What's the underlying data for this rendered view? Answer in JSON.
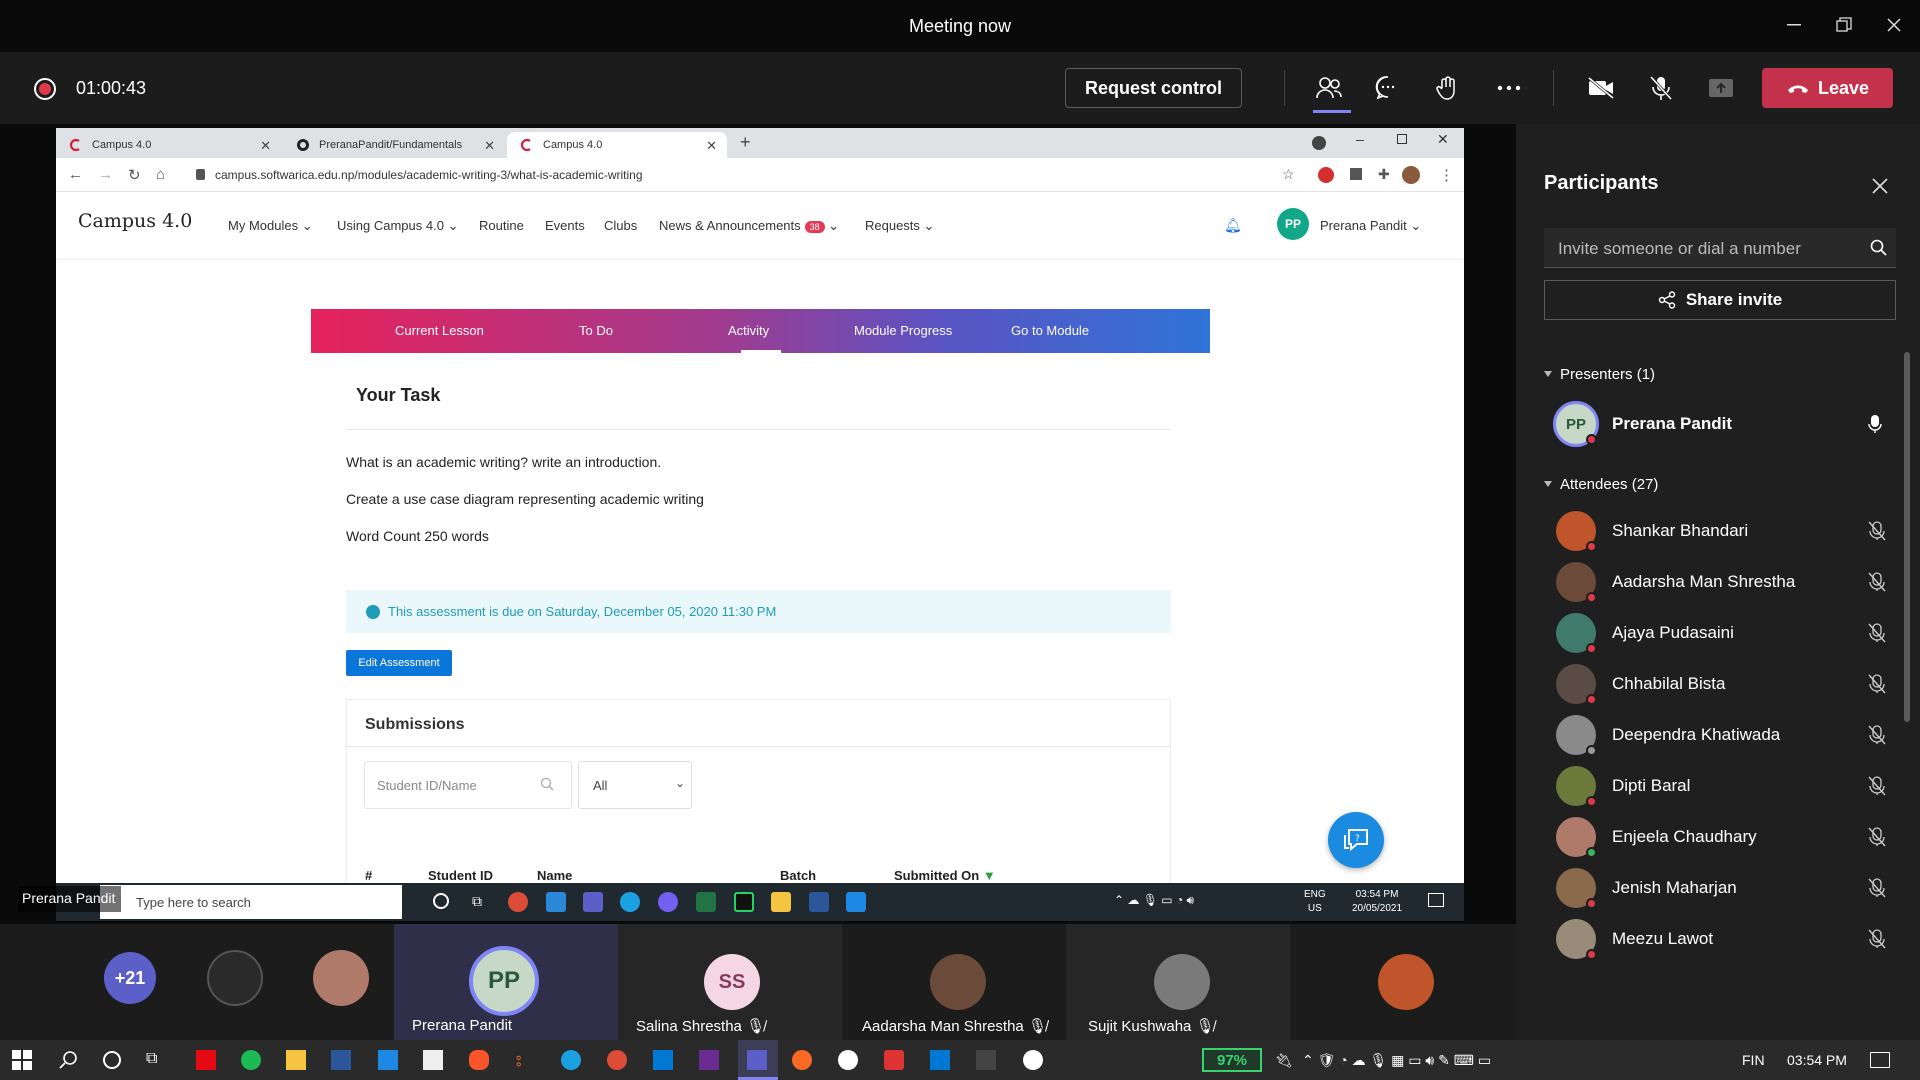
{
  "window": {
    "title": "Meeting now"
  },
  "toolbar": {
    "timer": "01:00:43",
    "request_control": "Request control",
    "leave": "Leave"
  },
  "browser": {
    "tabs": [
      {
        "label": "Campus 4.0",
        "active": false
      },
      {
        "label": "PreranaPandit/Fundamentals",
        "active": false
      },
      {
        "label": "Campus 4.0",
        "active": true
      }
    ],
    "url": "campus.softwarica.edu.np/modules/academic-writing-3/what-is-academic-writing"
  },
  "site": {
    "logo": "Campus 4.0",
    "menu": [
      "My Modules",
      "Using Campus 4.0",
      "Routine",
      "Events",
      "Clubs",
      "News & Announcements",
      "Requests"
    ],
    "news_badge": "38",
    "user_initials": "PP",
    "user_name": "Prerana Pandit",
    "lesson_tabs": [
      "Current Lesson",
      "To Do",
      "Activity",
      "Module Progress",
      "Go to Module"
    ],
    "active_tab": "Activity",
    "task_title": "Your Task",
    "task_lines": [
      "What is an academic writing? write an introduction.",
      "Create a use case diagram representing academic writing",
      "Word Count 250 words"
    ],
    "due_notice": "This assessment is due on Saturday, December 05, 2020 11:30 PM",
    "edit_button": "Edit Assessment",
    "submissions_title": "Submissions",
    "search_placeholder": "Student ID/Name",
    "filter_value": "All",
    "table_headers": [
      "#",
      "Student ID",
      "Name",
      "Batch",
      "Submitted On"
    ]
  },
  "inner_taskbar": {
    "search_placeholder": "Type here to search",
    "lang": "ENG",
    "region": "US",
    "time": "03:54 PM",
    "date": "20/05/2021"
  },
  "presenter_label": "Prerana Pandit",
  "participants": {
    "title": "Participants",
    "invite_placeholder": "Invite someone or dial a number",
    "share_invite": "Share invite",
    "presenters_header": "Presenters (1)",
    "presenters": [
      {
        "initials": "PP",
        "name": "Prerana Pandit"
      }
    ],
    "attendees_header": "Attendees (27)",
    "attendees": [
      {
        "name": "Shankar Bhandari",
        "color": "#c0542b",
        "status": "#e0394a"
      },
      {
        "name": "Aadarsha Man Shrestha",
        "color": "#6b4a3a",
        "status": "#e0394a"
      },
      {
        "name": "Ajaya Pudasaini",
        "color": "#3f7a6a",
        "status": "#e0394a"
      },
      {
        "name": "Chhabilal Bista",
        "color": "#5a4b45",
        "status": "#e0394a"
      },
      {
        "name": "Deependra Khatiwada",
        "color": "#8a8a8a",
        "status": "#9a9a9a"
      },
      {
        "name": "Dipti Baral",
        "color": "#6b7a3a",
        "status": "#e0394a"
      },
      {
        "name": "Enjeela Chaudhary",
        "color": "#b07a6a",
        "status": "#3bb55c"
      },
      {
        "name": "Jenish Maharjan",
        "color": "#8a6a4a",
        "status": "#e0394a"
      },
      {
        "name": "Meezu Lawot",
        "color": "#9a8a7a",
        "status": "#e0394a"
      }
    ]
  },
  "gallery": {
    "overflow": "+21",
    "tiles": [
      {
        "name": "Prerana Pandit",
        "initials": "PP"
      },
      {
        "name": "Salina Shrestha",
        "initials": "SS"
      },
      {
        "name": "Aadarsha Man Shrestha"
      },
      {
        "name": "Sujit Kushwaha"
      }
    ]
  },
  "os_taskbar": {
    "battery": "97%",
    "lang": "FIN",
    "time": "03:54 PM"
  }
}
